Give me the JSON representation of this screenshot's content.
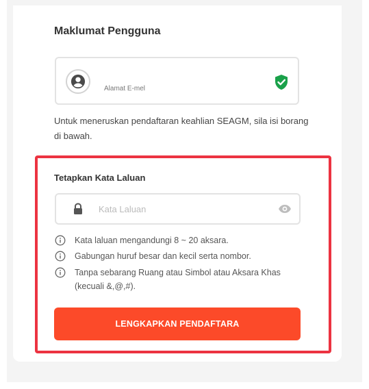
{
  "section": {
    "title": "Maklumat Pengguna"
  },
  "email": {
    "label": "Alamat E-mel",
    "avatar_icon": "user-icon",
    "status_icon": "shield-check-icon",
    "status_color": "#1aa14a"
  },
  "info": {
    "text": "Untuk meneruskan pendaftaran keahlian SEAGM, sila isi borang di bawah."
  },
  "password": {
    "title": "Tetapkan Kata Laluan",
    "placeholder": "Kata Laluan",
    "lock_icon": "lock-icon",
    "toggle_icon": "eye-icon",
    "rules": [
      {
        "icon": "info-icon",
        "text": "Kata laluan mengandungi 8 ~ 20 aksara."
      },
      {
        "icon": "info-icon",
        "text": "Gabungan huruf besar dan kecil serta nombor."
      },
      {
        "icon": "info-icon",
        "text": "Tanpa sebarang Ruang atau Simbol atau Aksara Khas (kecuali &,@,#)."
      }
    ]
  },
  "submit": {
    "label": "LENGKAPKAN PENDAFTARA",
    "color": "#fc4a29"
  },
  "highlight": {
    "color": "#ec3341"
  }
}
